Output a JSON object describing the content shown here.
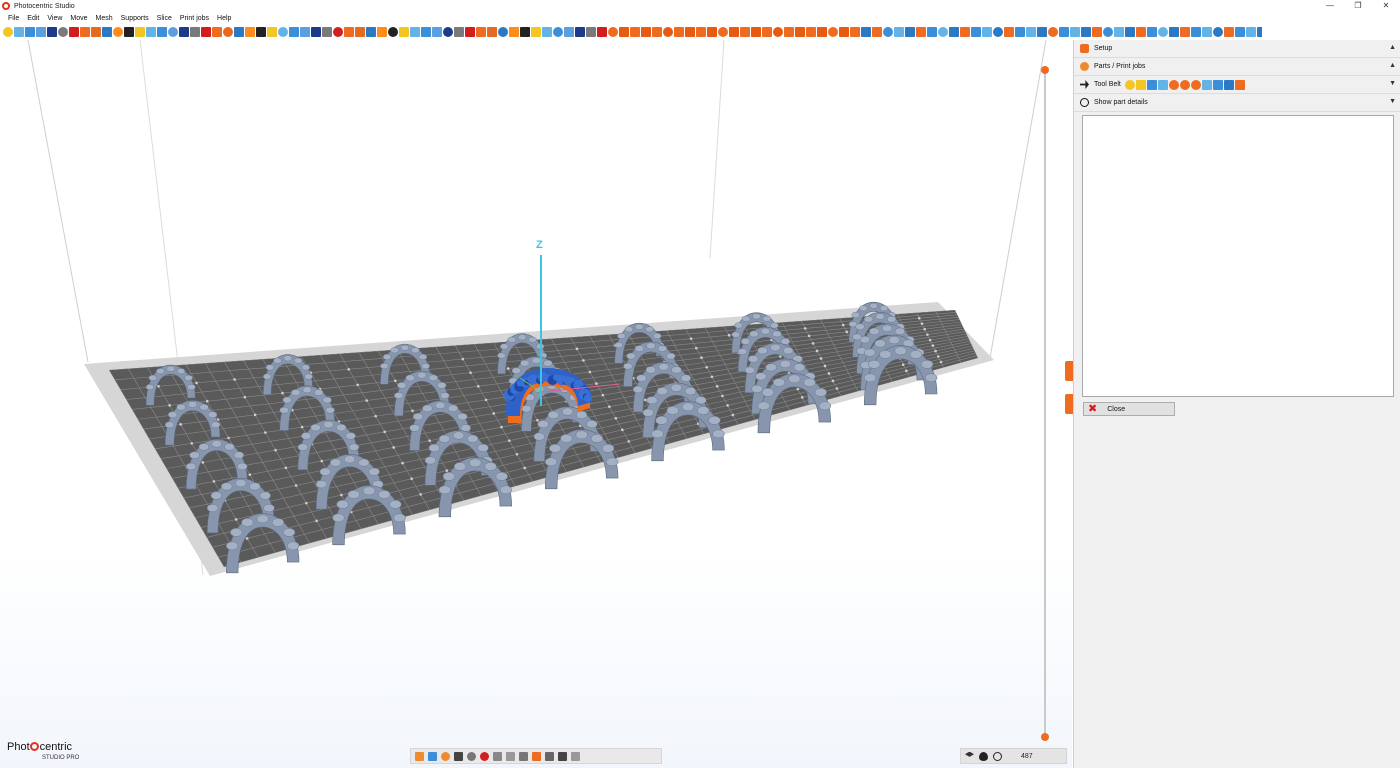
{
  "window": {
    "title": "Photocentric Studio",
    "controls": [
      "—",
      "❐",
      "✕"
    ]
  },
  "menu": [
    "File",
    "Edit",
    "View",
    "Move",
    "Mesh",
    "Supports",
    "Slice",
    "Print jobs",
    "Help"
  ],
  "viewport": {
    "axis_label": "Z"
  },
  "brand": {
    "pre": "Phot",
    "post": "centric",
    "sub": "STUDIO PRO"
  },
  "panel": {
    "setup_label": "Setup",
    "parts_label": "Parts / Print jobs",
    "toolbelt_label": "Tool Belt",
    "details_label": "Show part details",
    "close_label": "Close"
  },
  "layer": {
    "value": "487"
  },
  "colors": {
    "accent": "#ef6b1f",
    "model": "#8796ad",
    "selected_model": "#2f62c9",
    "selected_support": "#ef6b1f",
    "plate": "#5a5a5a",
    "plate_border": "#d3d3d3",
    "grid_line": "#8a8a8a",
    "z_axis": "#3fc4e0"
  }
}
